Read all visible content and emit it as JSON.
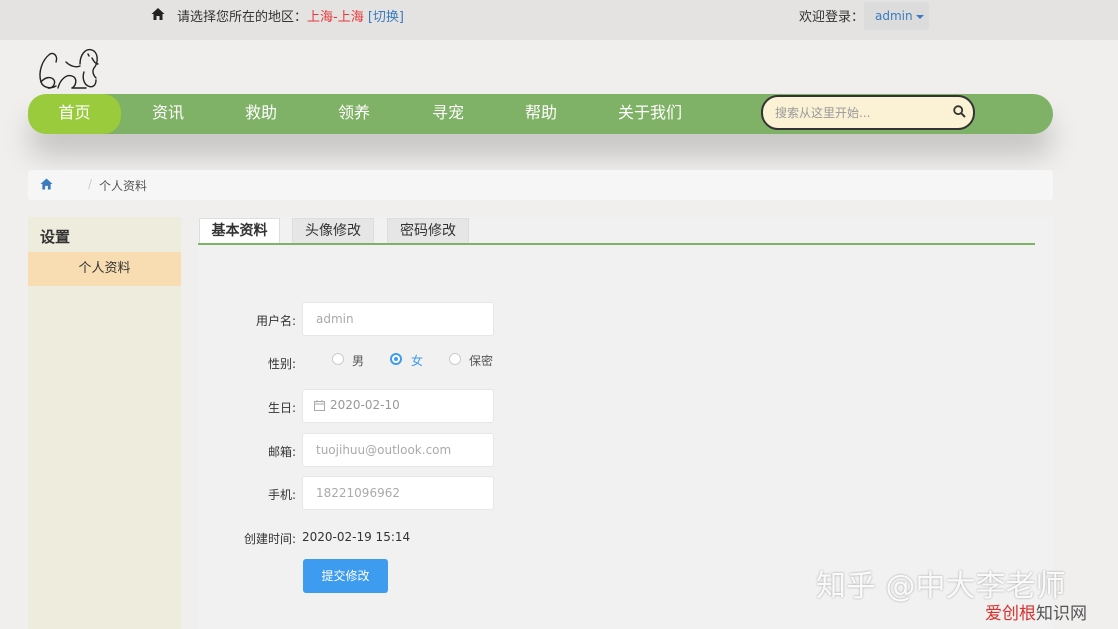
{
  "topbar": {
    "region_prompt": "请选择您所在的地区：",
    "region_city": "上海-上海",
    "region_switch": "[切换]",
    "welcome": "欢迎登录：",
    "user": "admin",
    "home_icon": "home-icon"
  },
  "nav": {
    "items": [
      "首页",
      "资讯",
      "救助",
      "领养",
      "寻宠",
      "帮助",
      "关于我们"
    ],
    "active_index": 0,
    "search_placeholder": "搜索从这里开始...",
    "search_icon": "search-icon"
  },
  "breadcrumb": {
    "current": "个人资料",
    "separator": "/"
  },
  "sidebar": {
    "title": "设置",
    "items": [
      "个人资料"
    ]
  },
  "tabs": [
    "基本资料",
    "头像修改",
    "密码修改"
  ],
  "form": {
    "username_label": "用户名:",
    "username_placeholder": "admin",
    "gender_label": "性别:",
    "gender_options": [
      "男",
      "女",
      "保密"
    ],
    "gender_selected": "女",
    "birthday_label": "生日:",
    "birthday_value": "2020-02-10",
    "email_label": "邮箱:",
    "email_placeholder": "tuojihuu@outlook.com",
    "phone_label": "手机:",
    "phone_placeholder": "18221096962",
    "created_label": "创建时间:",
    "created_value": "2020-02-19 15:14",
    "submit_label": "提交修改"
  },
  "watermark": {
    "line1": "知乎 @中大李老师",
    "line2a": "爱创根",
    "line2b": "知识网"
  },
  "colors": {
    "nav_green": "#7fb166",
    "nav_active": "#9acb3c",
    "primary_blue": "#3d9bf0",
    "sidebar_active": "#f8ddb3"
  }
}
